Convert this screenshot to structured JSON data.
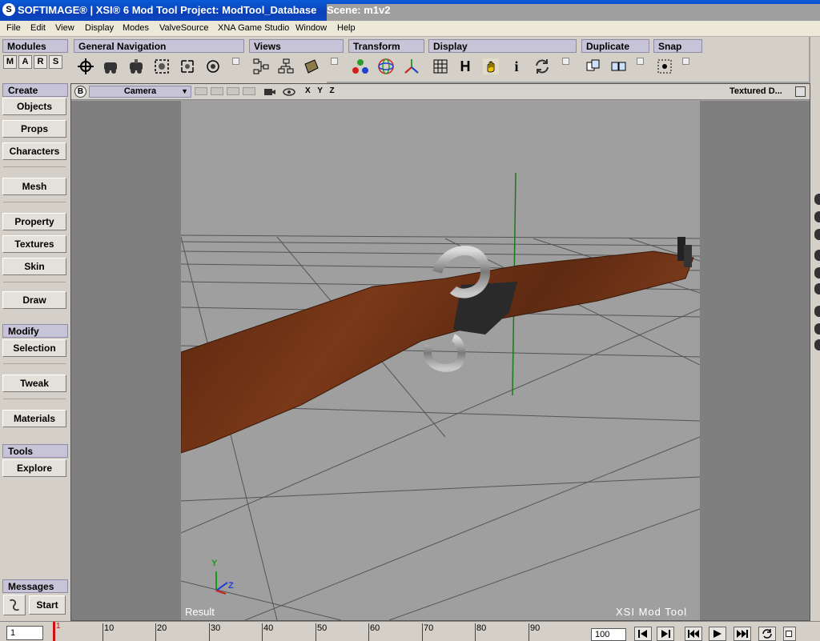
{
  "window": {
    "logo": "S",
    "title": "SOFTIMAGE® | XSI® 6 Mod Tool Project: ModTool_Database",
    "scene": "Scene: m1v2"
  },
  "menu": [
    "File",
    "Edit",
    "View",
    "Display",
    "Modes",
    "ValveSource",
    "XNA Game Studio",
    "Window",
    "Help"
  ],
  "toolbar": {
    "groups": [
      "Modules",
      "General Navigation",
      "Views",
      "Transform",
      "Display",
      "Duplicate",
      "Snap"
    ],
    "mars": [
      "M",
      "A",
      "R",
      "S"
    ],
    "h_button": "H",
    "info_button": "i"
  },
  "left_panel": {
    "create_label": "Create",
    "create_buttons": [
      "Objects",
      "Props",
      "Characters",
      "Mesh",
      "Property",
      "Textures",
      "Skin",
      "Draw"
    ],
    "modify_label": "Modify",
    "modify_buttons": [
      "Selection",
      "Tweak",
      "Materials"
    ],
    "tools_label": "Tools",
    "tools_buttons": [
      "Explore"
    ],
    "messages_label": "Messages",
    "start_button": "Start"
  },
  "viewport": {
    "b_button": "B",
    "camera": "Camera",
    "xyz": "X Y Z",
    "display_mode": "Textured D...",
    "result_label": "Result",
    "brand": "XSI  Mod  Tool",
    "axis_y": "Y",
    "axis_z": "Z"
  },
  "timeline": {
    "current_frame": "1",
    "end_frame": "100",
    "ticks": [
      "10",
      "20",
      "30",
      "40",
      "50",
      "60",
      "70",
      "80",
      "90"
    ],
    "current_marker": "1"
  },
  "colors": {
    "title_bg": "#0a47c0",
    "group_label_bg": "#c8c4d8",
    "viewport_bg": "#9f9f9f",
    "wood": "#6b2e12"
  }
}
